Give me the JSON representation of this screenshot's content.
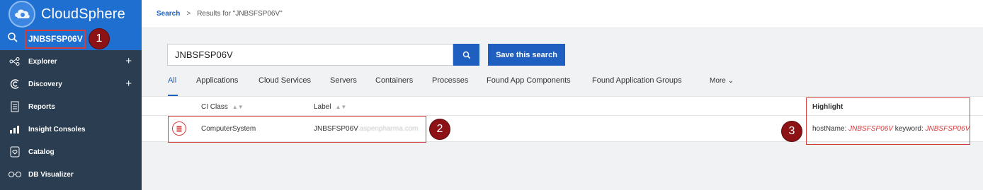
{
  "app": {
    "name": "CloudSphere",
    "search_value": "JNBSFSP06V"
  },
  "sidebar": {
    "items": [
      {
        "label": "Explorer",
        "icon": "explorer-icon",
        "expandable": true
      },
      {
        "label": "Discovery",
        "icon": "discovery-icon",
        "expandable": true
      },
      {
        "label": "Reports",
        "icon": "reports-icon",
        "expandable": false
      },
      {
        "label": "Insight Consoles",
        "icon": "insight-consoles-icon",
        "expandable": false
      },
      {
        "label": "Catalog",
        "icon": "catalog-icon",
        "expandable": false
      },
      {
        "label": "DB Visualizer",
        "icon": "db-visualizer-icon",
        "expandable": false
      }
    ],
    "expand_symbol": "+"
  },
  "breadcrumb": {
    "root": "Search",
    "separator": ">",
    "current": "Results for \"JNBSFSP06V\""
  },
  "search": {
    "value": "JNBSFSP06V",
    "save_label": "Save this search"
  },
  "tabs": [
    {
      "label": "All",
      "active": true
    },
    {
      "label": "Applications",
      "active": false
    },
    {
      "label": "Cloud Services",
      "active": false
    },
    {
      "label": "Servers",
      "active": false
    },
    {
      "label": "Containers",
      "active": false
    },
    {
      "label": "Processes",
      "active": false
    },
    {
      "label": "Found App Components",
      "active": false
    },
    {
      "label": "Found Application Groups",
      "active": false
    }
  ],
  "more_label": "More",
  "grid": {
    "columns": [
      "CI Class",
      "Label",
      "Highlight"
    ],
    "rows": [
      {
        "ci_class": "ComputerSystem",
        "label_prefix": "JNBSFSP06V",
        "label_suffix_blurred": ".aspenpharma.com",
        "highlight": {
          "key1": "hostName:",
          "val1": "JNBSFSP06V",
          "key2": "keyword:",
          "val2": "JNBSFSP06V"
        }
      }
    ]
  },
  "annotations": [
    "1",
    "2",
    "3"
  ],
  "colors": {
    "brand_blue": "#1f6fd1",
    "sidebar_bg": "#2b3d50",
    "primary_button": "#1f5fbf",
    "highlight_red": "#d43c3c",
    "marker_bg": "#8c1216"
  }
}
